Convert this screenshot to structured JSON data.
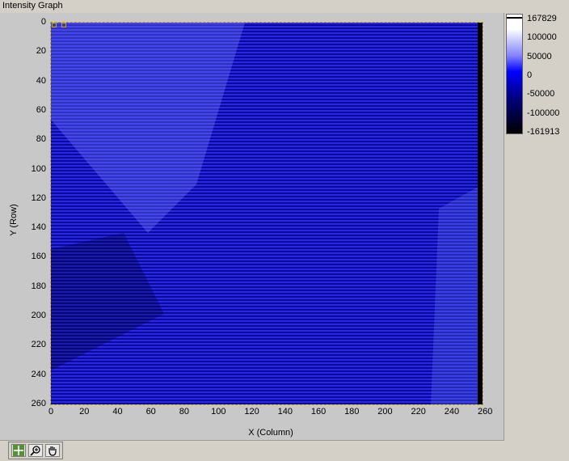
{
  "window": {
    "title": "Intensity Graph"
  },
  "graph": {
    "y_axis_label": "Y (Row)",
    "x_axis_label": "X (Column)",
    "y_ticks": [
      "0",
      "20",
      "40",
      "60",
      "80",
      "100",
      "120",
      "140",
      "160",
      "180",
      "200",
      "220",
      "240",
      "260"
    ],
    "x_ticks": [
      "0",
      "20",
      "40",
      "60",
      "80",
      "100",
      "120",
      "140",
      "160",
      "180",
      "200",
      "220",
      "240",
      "260"
    ]
  },
  "color_scale": {
    "labels": [
      "167829",
      "100000",
      "50000",
      "0",
      "-50000",
      "-100000",
      "-161913"
    ],
    "min": -161913,
    "max": 167829
  },
  "toolbar": {
    "tools": [
      {
        "name": "cursor-tool-icon"
      },
      {
        "name": "zoom-tool-icon"
      },
      {
        "name": "pan-tool-icon"
      }
    ]
  }
}
